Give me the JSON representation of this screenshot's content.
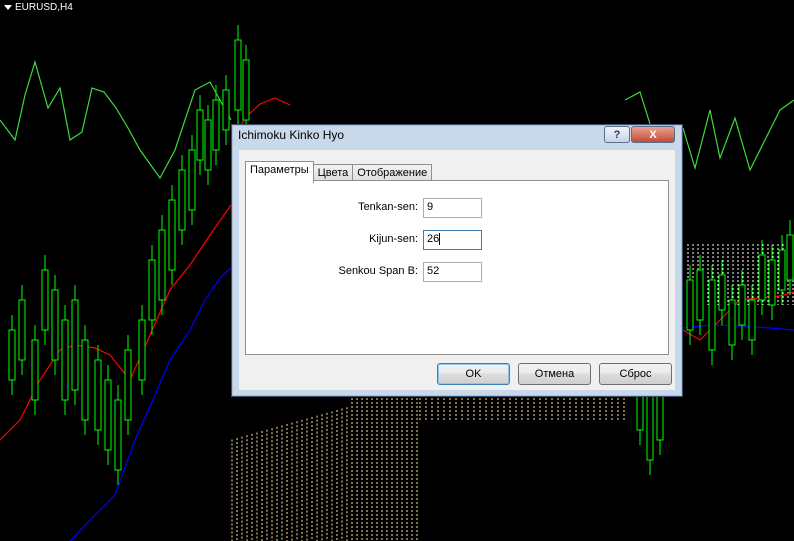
{
  "chart": {
    "symbol": "EURUSD,H4",
    "colors": {
      "background": "#000000",
      "candles": "#00ff00",
      "chikou": "#3cdc3c",
      "tenkan": "#ff0000",
      "kijun": "#0000ff",
      "cloud": "#ffdf9e"
    }
  },
  "dialog": {
    "title": "Ichimoku Kinko Hyo",
    "help_label": "?",
    "close_label": "X",
    "tabs": [
      {
        "label": "Параметры",
        "active": true
      },
      {
        "label": "Цвета",
        "active": false
      },
      {
        "label": "Отображение",
        "active": false
      }
    ],
    "params": [
      {
        "label": "Tenkan-sen:",
        "value": "9"
      },
      {
        "label": "Kijun-sen:",
        "value": "26"
      },
      {
        "label": "Senkou Span B:",
        "value": "52"
      }
    ],
    "buttons": {
      "ok": "OK",
      "cancel": "Отмена",
      "reset": "Сброс"
    }
  }
}
